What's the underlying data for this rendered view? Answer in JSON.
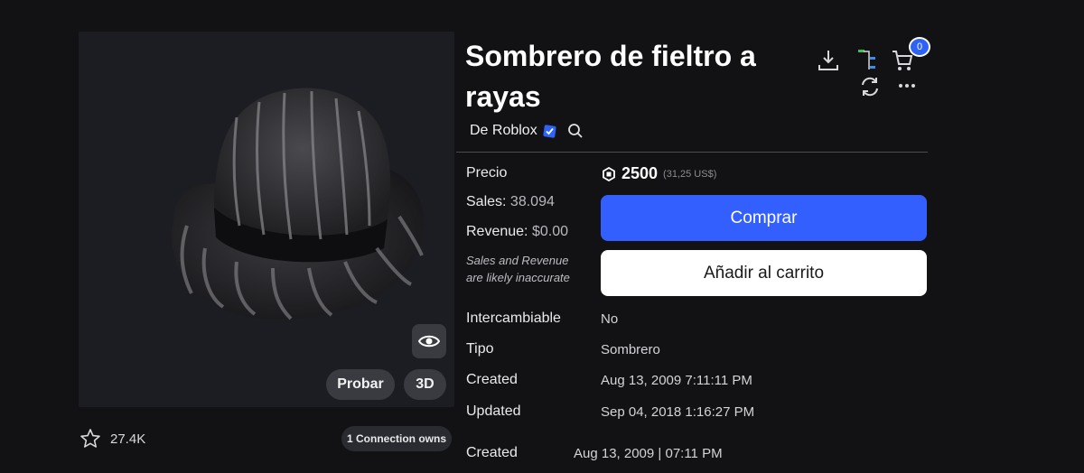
{
  "item": {
    "title": "Sombrero de fieltro a rayas",
    "creator_label": "De Roblox",
    "favorites": "27.4K",
    "connection_owns": "1 Connection owns"
  },
  "thumbnail": {
    "try_label": "Probar",
    "three_d_label": "3D"
  },
  "header": {
    "cart_count": "0"
  },
  "details": {
    "price_label": "Precio",
    "price_value": "2500",
    "price_usd": "(31,25 US$)",
    "sales_label": "Sales:",
    "sales_value": "38.094",
    "revenue_label": "Revenue:",
    "revenue_value": "$0.00",
    "note_line1": "Sales and Revenue",
    "note_line2": "are likely inaccurate",
    "tradable_label": "Intercambiable",
    "tradable_value": "No",
    "type_label": "Tipo",
    "type_value": "Sombrero",
    "created_label": "Created",
    "created_value": "Aug 13, 2009 7:11:11 PM",
    "updated_label": "Updated",
    "updated_value": "Sep 04, 2018 1:16:27 PM",
    "created2_label": "Created",
    "created2_value": "Aug 13, 2009 | 07:11 PM"
  },
  "actions": {
    "buy_label": "Comprar",
    "add_to_cart_label": "Añadir al carrito"
  },
  "colors": {
    "background": "#121215",
    "buy_button": "#335fff",
    "badge": "#2f63f5",
    "verified": "#2f63f5"
  },
  "icons": [
    "download-icon",
    "tree-icon",
    "cart-icon",
    "refresh-icon",
    "more-icon",
    "eye-icon",
    "star-icon",
    "search-icon",
    "verified-badge-icon",
    "robux-icon"
  ]
}
